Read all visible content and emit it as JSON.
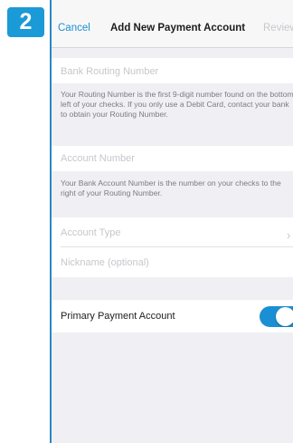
{
  "step": {
    "number": "2"
  },
  "navbar": {
    "cancel_label": "Cancel",
    "title": "Add New Payment Account",
    "review_label": "Review"
  },
  "form": {
    "routing": {
      "placeholder": "Bank Routing Number",
      "helper": "Your Routing Number is the first 9-digit number found on the bottom left of your checks. If you only use a Debit Card, contact your bank to obtain your Routing Number."
    },
    "account": {
      "placeholder": "Account Number",
      "helper": "Your Bank Account Number is the number on your checks to the right of your Routing Number."
    },
    "account_type": {
      "placeholder": "Account Type",
      "chevron_icon": "chevron-right-icon"
    },
    "nickname": {
      "placeholder": "Nickname (optional)"
    },
    "primary": {
      "label": "Primary Payment Account",
      "enabled": true
    }
  },
  "colors": {
    "accent": "#1a8fd4",
    "badge": "#1a9ad6",
    "background": "#efeff4",
    "placeholder": "#c7c7cc"
  }
}
